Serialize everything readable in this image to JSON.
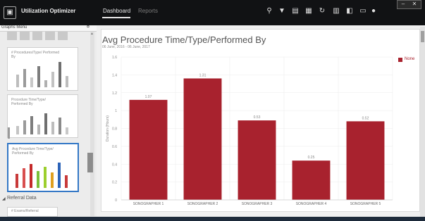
{
  "app": {
    "title": "Utilization Optimizer"
  },
  "nav": {
    "tabs": [
      {
        "label": "Dashboard",
        "active": true
      },
      {
        "label": "Reports",
        "active": false
      }
    ]
  },
  "toolbar": {
    "icons": [
      "pin-icon",
      "filter-icon",
      "print-icon",
      "save-icon",
      "refresh-icon",
      "add-chart-icon",
      "share-icon",
      "comment-icon",
      "help-icon"
    ]
  },
  "window": {
    "minimize": "–",
    "close": "✕"
  },
  "sidebar": {
    "header": "Graphs Menu",
    "pin": "¤",
    "cards": [
      {
        "title": "# Procedures/Type/ Performed By"
      },
      {
        "title": "Procedure Time/Type/ Performed By"
      },
      {
        "title": "Avg Procedure Time/Type/ Performed By",
        "selected": true
      }
    ],
    "section": "Referral Data",
    "section_arrow": "◢",
    "next_card": "# Exams/Referral"
  },
  "chart_data": {
    "type": "bar",
    "title": "Avg Procedure Time/Type/Performed By",
    "subtitle": "06 June, 2016 - 06 June, 2017",
    "ylabel": "Duration (Hours)",
    "xlabel": "",
    "categories": [
      "SONOGRAPHER 1",
      "SONOGRAPHER 2",
      "SONOGRAPHER 3",
      "SONOGRAPHER 4",
      "SONOGRAPHER 5"
    ],
    "series": [
      {
        "name": "None",
        "values": [
          1.12,
          1.36,
          0.89,
          0.44,
          0.88
        ],
        "color": "#a8222e"
      }
    ],
    "data_labels": [
      "1.07",
      "1.31",
      "0.53",
      "0.25",
      "0.52"
    ],
    "yticks": [
      "0",
      "0.2",
      "0.4",
      "0.6",
      "0.8",
      "1",
      "1.2",
      "1.4",
      "1.6"
    ],
    "ylim": [
      0,
      1.6
    ],
    "grid": true,
    "legend": "top-right"
  }
}
